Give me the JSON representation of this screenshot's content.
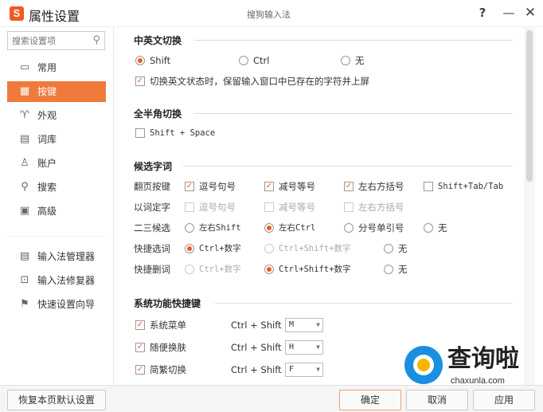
{
  "window": {
    "logo_letter": "S",
    "title": "属性设置",
    "caption": "搜狗输入法",
    "help": "?",
    "minimize": "—",
    "close": "✕"
  },
  "sidebar": {
    "search_placeholder": "搜索设置项",
    "items": [
      {
        "label": "常用",
        "icon": "monitor-icon"
      },
      {
        "label": "按键",
        "icon": "keyboard-icon",
        "active": true
      },
      {
        "label": "外观",
        "icon": "shirt-icon"
      },
      {
        "label": "词库",
        "icon": "book-icon"
      },
      {
        "label": "账户",
        "icon": "user-icon"
      },
      {
        "label": "搜索",
        "icon": "search-icon"
      },
      {
        "label": "高级",
        "icon": "grid-icon"
      }
    ],
    "tools": [
      {
        "label": "输入法管理器",
        "icon": "list-icon"
      },
      {
        "label": "输入法修复器",
        "icon": "repair-icon"
      },
      {
        "label": "快速设置向导",
        "icon": "flag-icon"
      }
    ]
  },
  "cn_en_switch": {
    "title": "中英文切换",
    "options": [
      "Shift",
      "Ctrl",
      "无"
    ],
    "selected": "Shift",
    "keep_chars_label": "切换英文状态时，保留输入窗口中已存在的字符并上屏",
    "keep_chars_checked": true
  },
  "full_half": {
    "title": "全半角切换",
    "option": "Shift + Space",
    "checked": false
  },
  "candidate": {
    "title": "候选字词",
    "page_label": "翻页按键",
    "page_opts": [
      {
        "label": "逗号句号",
        "checked": true
      },
      {
        "label": "减号等号",
        "checked": true
      },
      {
        "label": "左右方括号",
        "checked": true
      },
      {
        "label": "Shift+Tab/Tab",
        "checked": false
      }
    ],
    "word_label": "以词定字",
    "word_opts": [
      "逗号句号",
      "减号等号",
      "左右方括号"
    ],
    "second_label": "二三候选",
    "second_opts": [
      "左右Shift",
      "左右Ctrl",
      "分号单引号",
      "无"
    ],
    "second_selected": "左右Ctrl",
    "quick_select_label": "快捷选词",
    "quick_select_opts": [
      "Ctrl+数字",
      "Ctrl+Shift+数字",
      "无"
    ],
    "quick_select_selected": "Ctrl+数字",
    "quick_delete_label": "快捷删词",
    "quick_delete_opts": [
      "Ctrl+数字",
      "Ctrl+Shift+数字",
      "无"
    ],
    "quick_delete_selected": "Ctrl+Shift+数字"
  },
  "hotkeys": {
    "title": "系统功能快捷键",
    "prefix": "Ctrl + Shift +",
    "items": [
      {
        "label": "系统菜单",
        "key": "M",
        "checked": true
      },
      {
        "label": "随便换肤",
        "key": "H",
        "checked": true
      },
      {
        "label": "简繁切换",
        "key": "F",
        "checked": true
      }
    ]
  },
  "footer": {
    "reset": "恢复本页默认设置",
    "ok": "确定",
    "cancel": "取消",
    "apply": "应用"
  },
  "watermark": {
    "text": "查询啦",
    "url": "chaxunla.com"
  },
  "colors": {
    "accent": "#f07a3c",
    "brand": "#f05a22"
  }
}
